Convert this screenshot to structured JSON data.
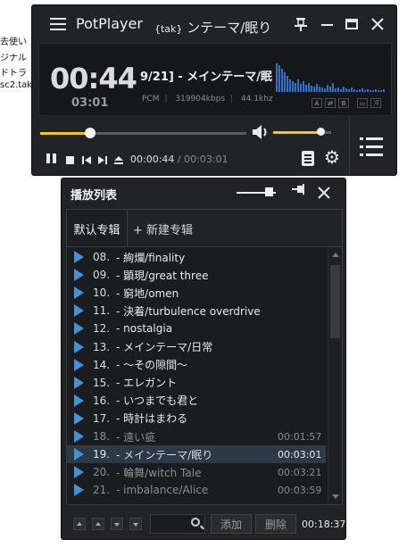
{
  "background_text": [
    "去使い",
    "ジナル",
    "ドトラ",
    "sc2.tak"
  ],
  "player": {
    "app_title": "PotPlayer",
    "title_tag": "{tak}",
    "title_track": "ンテーマ/眠り",
    "current_time_big": "00:44",
    "total_time_small": "03:01",
    "now_playing": "9/21]  - メインテーマ/眠",
    "format": "PCM",
    "bitrate": "319904kbps",
    "samplerate": "44.1khz",
    "small_buttons": [
      "A",
      "⇄",
      "B",
      "▭",
      "⤨"
    ],
    "time_current": "00:00:44",
    "time_sep": "/",
    "time_total": "00:03:01",
    "seek_progress": 0.243,
    "volume_level": 0.82,
    "colors": {
      "accent": "#f2c618",
      "spectrum": "#2a74c8"
    }
  },
  "playlist": {
    "title": "播放列表",
    "volume_level": 0.82,
    "tabs": {
      "default": "默认专辑",
      "new": "+ 新建专辑"
    },
    "items": [
      {
        "num": "08.",
        "name": "- 絢爛/finality",
        "dur": "",
        "dim": false
      },
      {
        "num": "09.",
        "name": "- 顕現/great three",
        "dur": "",
        "dim": false
      },
      {
        "num": "10.",
        "name": "- 窮地/omen",
        "dur": "",
        "dim": false
      },
      {
        "num": "11.",
        "name": "- 決着/turbulence overdrive",
        "dur": "",
        "dim": false
      },
      {
        "num": "12.",
        "name": "- nostalgia",
        "dur": "",
        "dim": false
      },
      {
        "num": "13.",
        "name": "- メインテーマ/日常",
        "dur": "",
        "dim": false
      },
      {
        "num": "14.",
        "name": "- ～その隙間～",
        "dur": "",
        "dim": false
      },
      {
        "num": "15.",
        "name": "- エレガント",
        "dur": "",
        "dim": false
      },
      {
        "num": "16.",
        "name": "- いつまでも君と",
        "dur": "",
        "dim": false
      },
      {
        "num": "17.",
        "name": "- 時計はまわる",
        "dur": "",
        "dim": false
      },
      {
        "num": "18.",
        "name": "- 遠い疵",
        "dur": "00:01:57",
        "dim": true
      },
      {
        "num": "19.",
        "name": "- メインテーマ/眠り",
        "dur": "00:03:01",
        "dim": false,
        "selected": true
      },
      {
        "num": "20.",
        "name": "- 輪舞/witch Tale",
        "dur": "00:03:21",
        "dim": true
      },
      {
        "num": "21.",
        "name": "- imbalance/Alice",
        "dur": "00:03:59",
        "dim": true
      }
    ],
    "add_label": "添加",
    "delete_label": "删除",
    "total_duration": "00:18:37"
  }
}
